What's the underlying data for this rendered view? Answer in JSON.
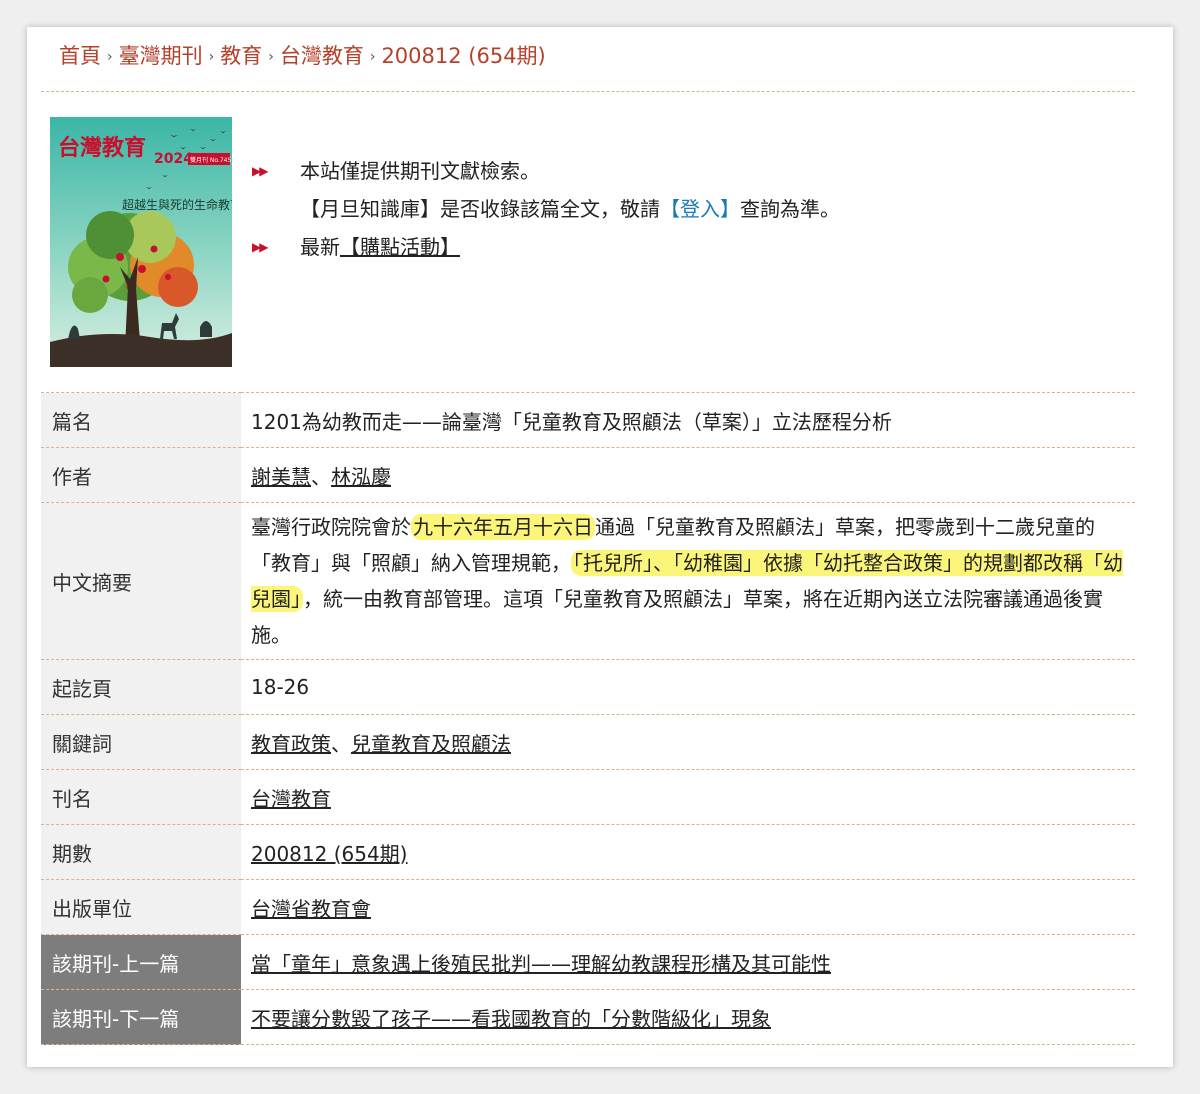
{
  "breadcrumb": [
    "首頁",
    "臺灣期刊",
    "教育",
    "台灣教育",
    "200812 (654期)"
  ],
  "breadcrumb_separator": "›",
  "cover": {
    "title_text": "台灣教育",
    "year_text": "2024",
    "issue_text": "雙月刊 No.745",
    "slogan_text": "超越生與死的生命教育"
  },
  "notice": {
    "line1": "本站僅提供期刊文獻檢索。",
    "line2_prefix": "【月旦知識庫】是否收錄該篇全文，敬請",
    "line2_link": "【登入】",
    "line2_suffix": "查詢為準。",
    "line3_prefix": "最新",
    "line3_link": "【購點活動】"
  },
  "table": {
    "title_label": "篇名",
    "title_value": "1201為幼教而走——論臺灣「兒童教育及照顧法（草案）」立法歷程分析",
    "author_label": "作者",
    "authors": [
      "謝美慧",
      "林泓慶"
    ],
    "author_sep": "、",
    "abstract_label": "中文摘要",
    "abstract": {
      "p1": "臺灣行政院院會於",
      "hl1": "九十六年五月十六日",
      "p2": "通過「兒童教育及照顧法」草案，把零歲到十二歲兒童的「教育」與「照顧」納入管理規範，",
      "hl2": "「托兒所」、「幼稚園」依據「幼托整合政策」的規劃都改稱「幼兒園」",
      "p3": "，統一由教育部管理。這項「兒童教育及照顧法」草案，將在近期內送立法院審議通過後實施。"
    },
    "pages_label": "起訖頁",
    "pages_value": "18-26",
    "keywords_label": "關鍵詞",
    "keywords": [
      "教育政策",
      "兒童教育及照顧法"
    ],
    "journal_label": "刊名",
    "journal_value": "台灣教育",
    "issue_label": "期數",
    "issue_value": "200812 (654期)",
    "publisher_label": "出版單位",
    "publisher_value": "台灣省教育會",
    "prev_label": "該期刊-上一篇",
    "prev_value": "當「童年」意象遇上後殖民批判——理解幼教課程形構及其可能性",
    "next_label": "該期刊-下一篇",
    "next_value": "不要讓分數毀了孩子——看我國教育的「分數階級化」現象"
  },
  "colors": {
    "breadcrumb": "#b5412a",
    "arrow": "#c8102e",
    "login_link": "#1a7bb8",
    "highlight": "#fbf57a",
    "dark_label_bg": "#7d7d7d",
    "label_bg": "#f1f1f1",
    "divider": "#d9b48a"
  }
}
